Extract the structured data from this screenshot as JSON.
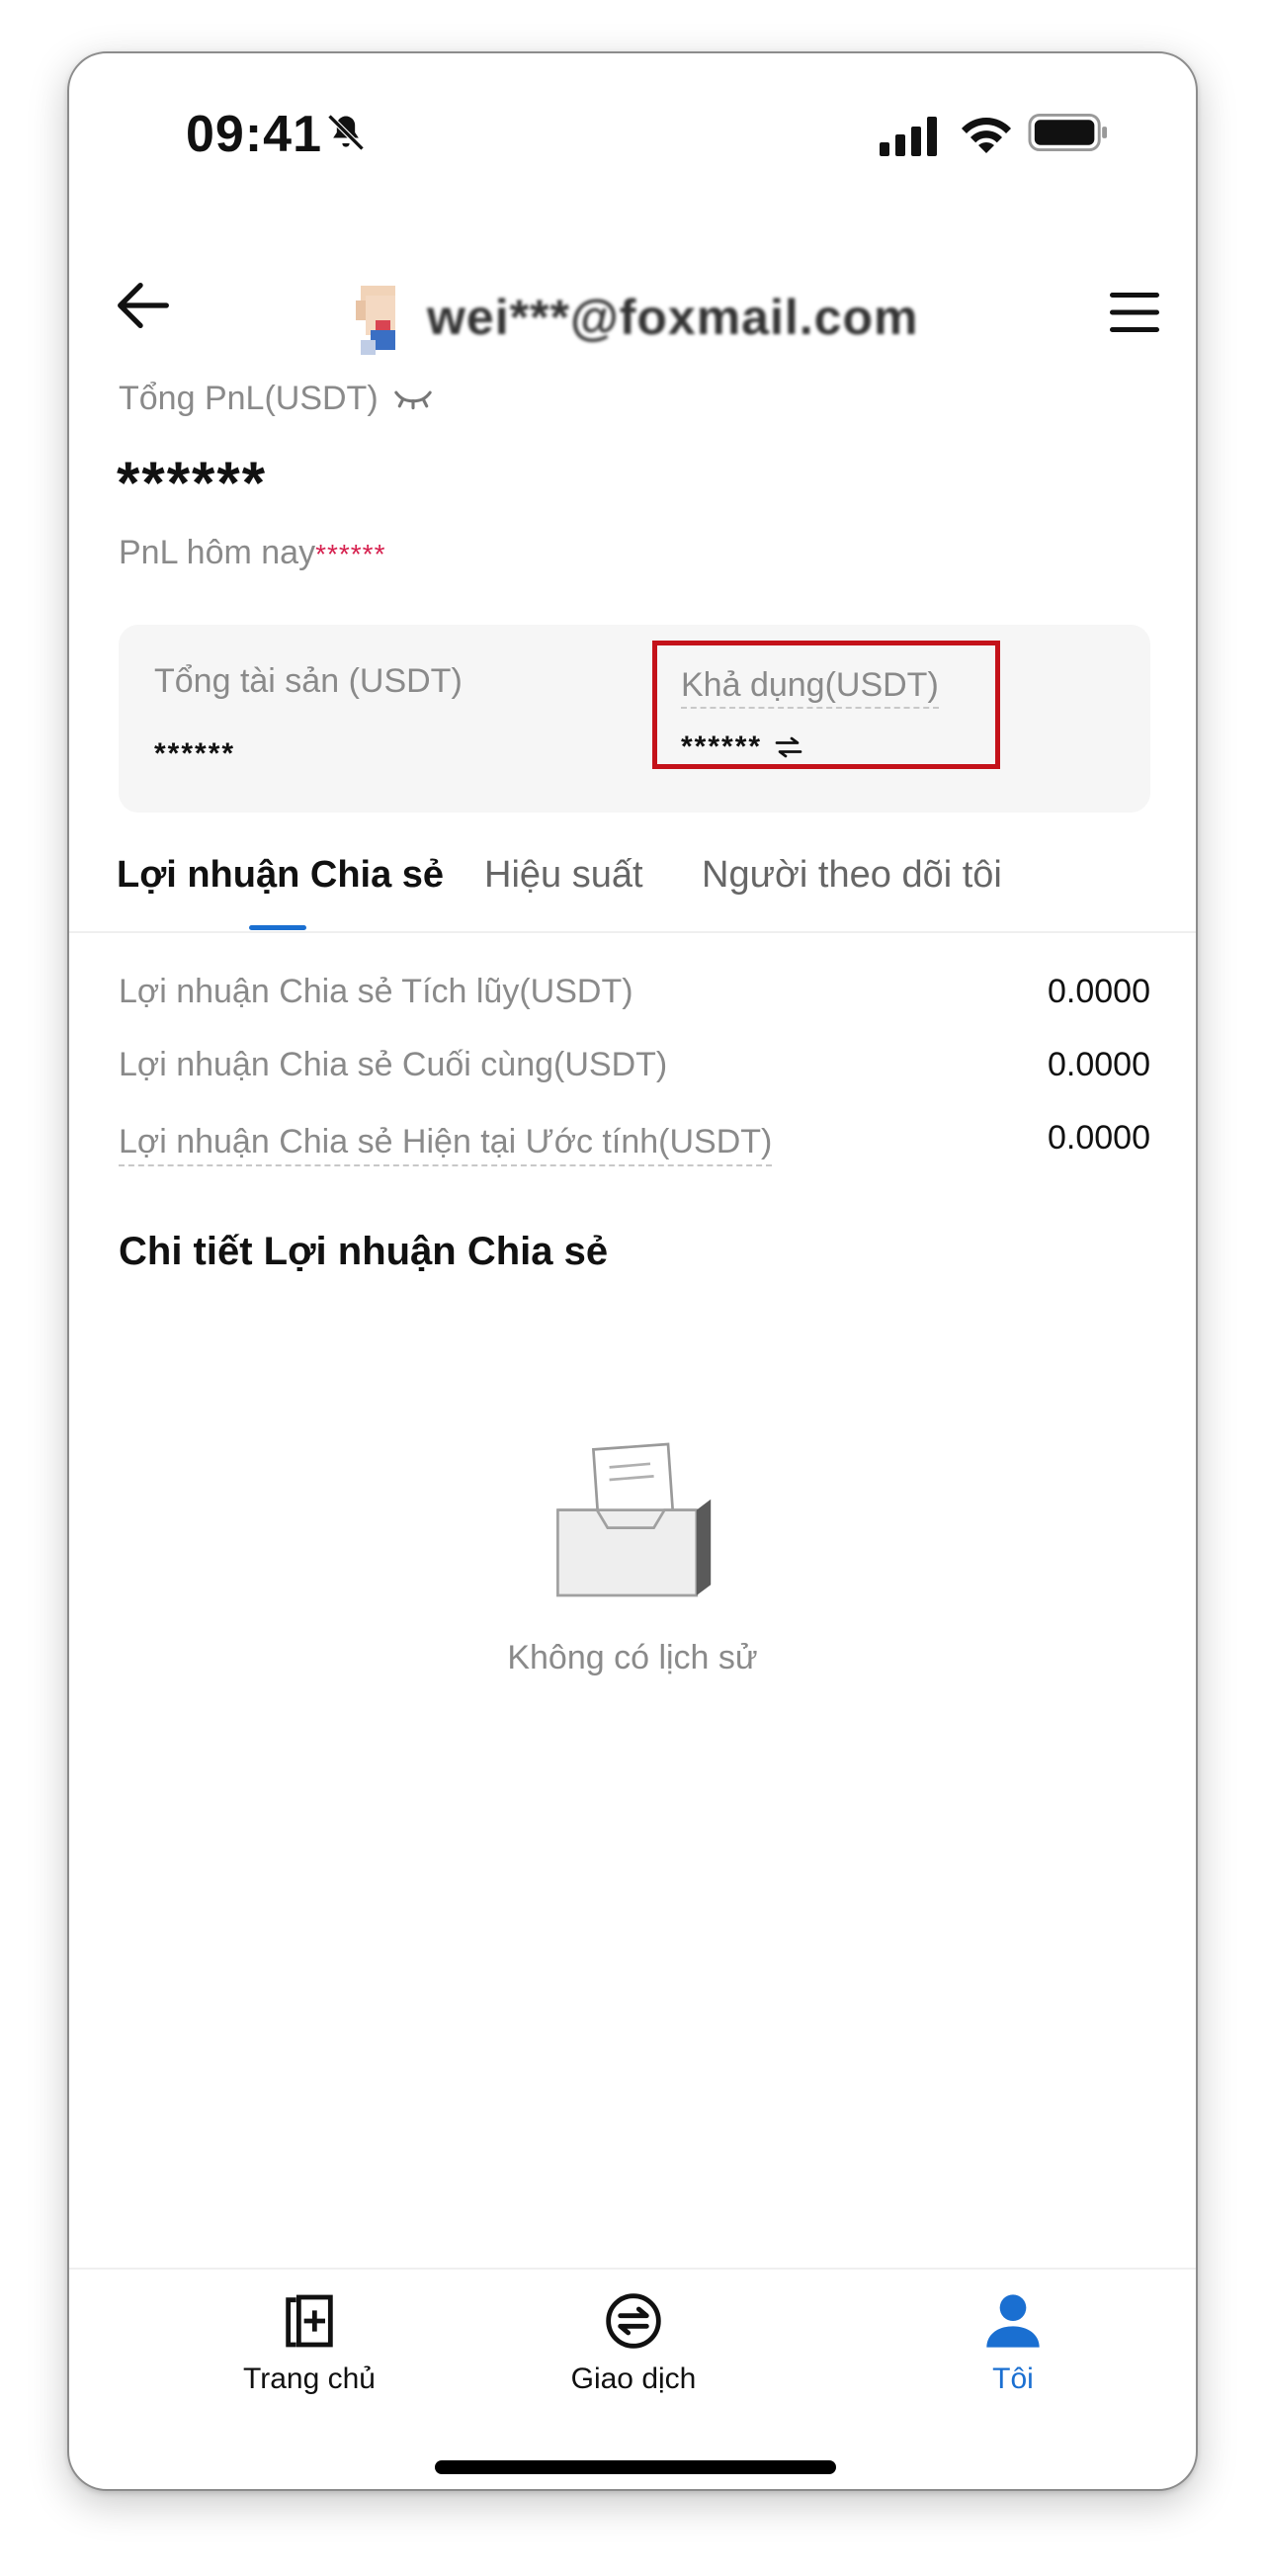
{
  "status_bar": {
    "time": "09:41"
  },
  "header": {
    "email": "wei***@foxmail.com"
  },
  "pnl": {
    "label": "Tổng PnL(USDT)",
    "value": "******",
    "today_label": "PnL hôm nay",
    "today_value": "******"
  },
  "assets": {
    "total_label": "Tổng tài sản (USDT)",
    "total_value": "******",
    "available_label": "Khả dụng(USDT)",
    "available_value": "******"
  },
  "tabs": [
    {
      "label": "Lợi nhuận Chia sẻ"
    },
    {
      "label": "Hiệu suất"
    },
    {
      "label": "Người theo dõi tôi"
    }
  ],
  "stats": [
    {
      "label": "Lợi nhuận Chia sẻ Tích lũy(USDT)",
      "value": "0.0000"
    },
    {
      "label": "Lợi nhuận Chia sẻ Cuối cùng(USDT)",
      "value": "0.0000"
    },
    {
      "label": "Lợi nhuận Chia sẻ Hiện tại Ước tính(USDT)",
      "value": "0.0000"
    }
  ],
  "detail": {
    "title": "Chi tiết Lợi nhuận Chia sẻ",
    "empty_text": "Không có lịch sử"
  },
  "bottom_nav": [
    {
      "label": "Trang chủ",
      "icon": "home-icon"
    },
    {
      "label": "Giao dịch",
      "icon": "trade-icon"
    },
    {
      "label": "Tôi",
      "icon": "user-icon"
    }
  ],
  "colors": {
    "accent": "#1a6fd1",
    "highlight_box": "#c4121a",
    "mask_red": "#d6204e"
  }
}
